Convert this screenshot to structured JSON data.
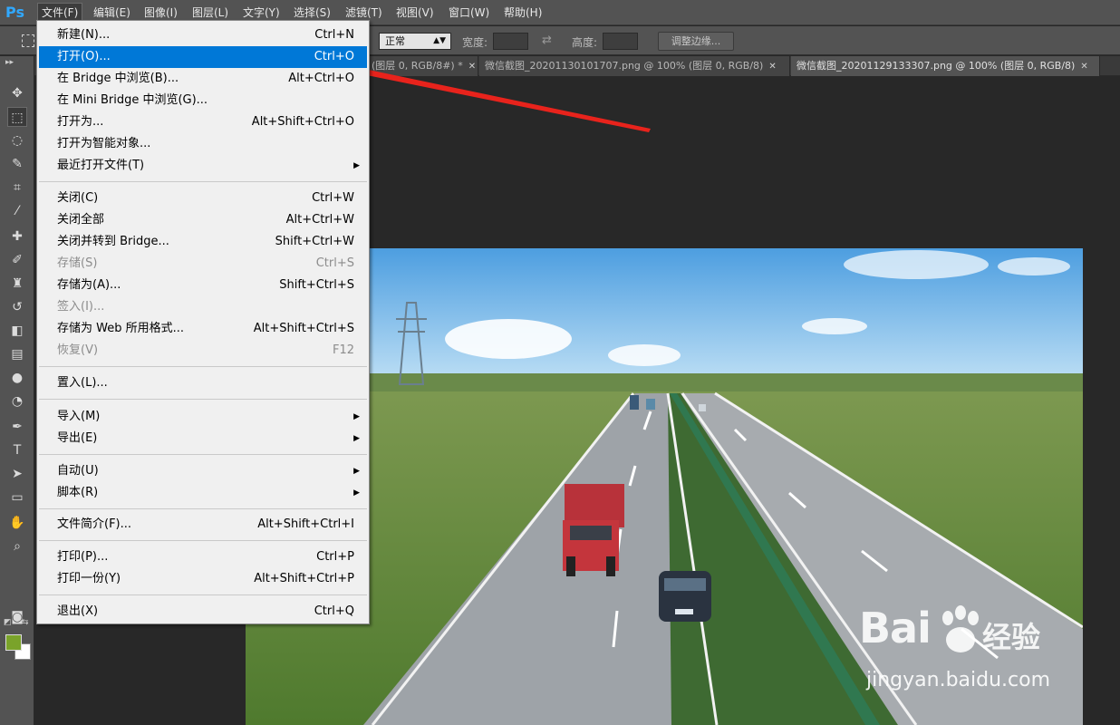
{
  "app": {
    "logo": "Ps"
  },
  "menubar": {
    "items": [
      "文件(F)",
      "编辑(E)",
      "图像(I)",
      "图层(L)",
      "文字(Y)",
      "选择(S)",
      "滤镜(T)",
      "视图(V)",
      "窗口(W)",
      "帮助(H)"
    ]
  },
  "options": {
    "style_value": "正常",
    "width_label": "宽度:",
    "height_label": "高度:",
    "refine_label": "调整边缘..."
  },
  "tabs": [
    {
      "title": "(图层 0, RGB/8#) *"
    },
    {
      "title": "微信截图_20201130101707.png @ 100% (图层 0, RGB/8)"
    },
    {
      "title": "微信截图_20201129133307.png @ 100% (图层 0, RGB/8)"
    }
  ],
  "file_menu": {
    "items": [
      {
        "label": "新建(N)...",
        "shortcut": "Ctrl+N"
      },
      {
        "label": "打开(O)...",
        "shortcut": "Ctrl+O"
      },
      {
        "label": "在 Bridge 中浏览(B)...",
        "shortcut": "Alt+Ctrl+O"
      },
      {
        "label": "在 Mini Bridge 中浏览(G)...",
        "shortcut": ""
      },
      {
        "label": "打开为...",
        "shortcut": "Alt+Shift+Ctrl+O"
      },
      {
        "label": "打开为智能对象...",
        "shortcut": ""
      },
      {
        "label": "最近打开文件(T)",
        "shortcut": ""
      },
      {
        "label": "关闭(C)",
        "shortcut": "Ctrl+W"
      },
      {
        "label": "关闭全部",
        "shortcut": "Alt+Ctrl+W"
      },
      {
        "label": "关闭并转到 Bridge...",
        "shortcut": "Shift+Ctrl+W"
      },
      {
        "label": "存储(S)",
        "shortcut": "Ctrl+S"
      },
      {
        "label": "存储为(A)...",
        "shortcut": "Shift+Ctrl+S"
      },
      {
        "label": "签入(I)...",
        "shortcut": ""
      },
      {
        "label": "存储为 Web 所用格式...",
        "shortcut": "Alt+Shift+Ctrl+S"
      },
      {
        "label": "恢复(V)",
        "shortcut": "F12"
      },
      {
        "label": "置入(L)...",
        "shortcut": ""
      },
      {
        "label": "导入(M)",
        "shortcut": ""
      },
      {
        "label": "导出(E)",
        "shortcut": ""
      },
      {
        "label": "自动(U)",
        "shortcut": ""
      },
      {
        "label": "脚本(R)",
        "shortcut": ""
      },
      {
        "label": "文件简介(F)...",
        "shortcut": "Alt+Shift+Ctrl+I"
      },
      {
        "label": "打印(P)...",
        "shortcut": "Ctrl+P"
      },
      {
        "label": "打印一份(Y)",
        "shortcut": "Alt+Shift+Ctrl+P"
      },
      {
        "label": "退出(X)",
        "shortcut": "Ctrl+Q"
      }
    ]
  },
  "colors": {
    "foreground": "#7aa32a",
    "background": "#ffffff",
    "highlight": "#0078d7",
    "annotation_arrow": "#e8231c"
  },
  "watermark": {
    "brand": "Bai",
    "brand_suffix": "经验",
    "url": "jingyan.baidu.com"
  }
}
